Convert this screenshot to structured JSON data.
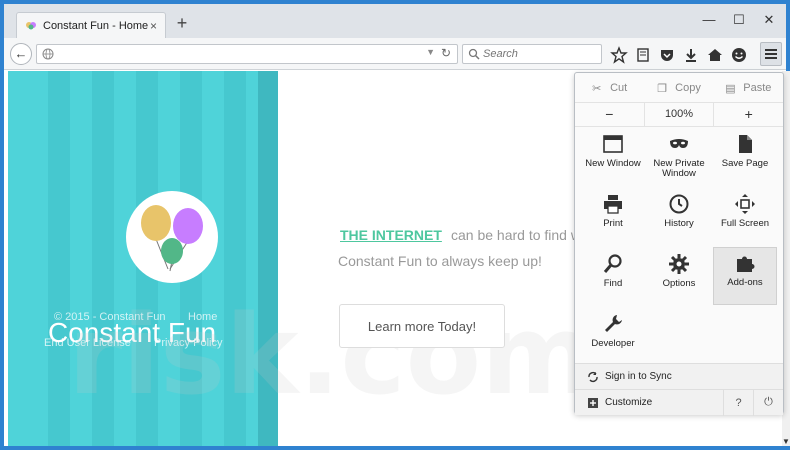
{
  "browser": {
    "tab_title": "Constant Fun - Home Page",
    "tab_close": "×",
    "new_tab": "+",
    "minimize": "—",
    "maximize": "☐",
    "close": "✕",
    "back": "←",
    "search_placeholder": "Search"
  },
  "page": {
    "brand": "Constant Fun",
    "footer_copyright": "© 2015 - Constant Fun",
    "footer_home": "Home",
    "footer_eula": "End User License",
    "footer_privacy": "Privacy Policy",
    "headline_link": "THE INTERNET",
    "headline_rest": "can be hard to find w",
    "subline": "Constant Fun to always keep up!",
    "cta": "Learn more Today!",
    "watermark": "risk.com"
  },
  "menu": {
    "cut": "Cut",
    "copy": "Copy",
    "paste": "Paste",
    "zoom_out": "−",
    "zoom": "100%",
    "zoom_in": "+",
    "items": [
      {
        "label": "New Window",
        "icon": "window-icon"
      },
      {
        "label": "New Private Window",
        "icon": "mask-icon"
      },
      {
        "label": "Save Page",
        "icon": "page-icon"
      },
      {
        "label": "Print",
        "icon": "printer-icon"
      },
      {
        "label": "History",
        "icon": "clock-icon"
      },
      {
        "label": "Full Screen",
        "icon": "fullscreen-icon"
      },
      {
        "label": "Find",
        "icon": "magnifier-icon"
      },
      {
        "label": "Options",
        "icon": "gear-icon"
      },
      {
        "label": "Add-ons",
        "icon": "puzzle-icon"
      },
      {
        "label": "Developer",
        "icon": "wrench-icon"
      }
    ],
    "sync": "Sign in to Sync",
    "customize": "Customize",
    "help": "?",
    "quit": "⏻"
  },
  "colors": {
    "window_border": "#2f82d0",
    "hero_teal": "#4fd3d9",
    "link_green": "#4ec79f"
  }
}
